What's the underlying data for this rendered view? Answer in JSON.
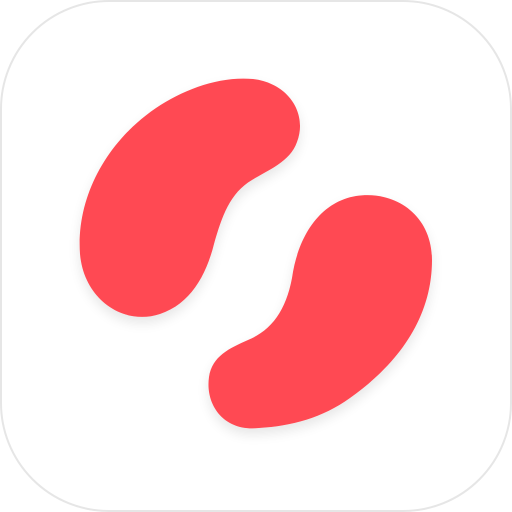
{
  "app_icon": {
    "icon_name": "two-red-bean-blobs-icon",
    "colors": {
      "background": "#ffffff",
      "tile": "#ffffff",
      "tile_border": "#e6e6e6",
      "accent": "#ff4a52"
    }
  }
}
